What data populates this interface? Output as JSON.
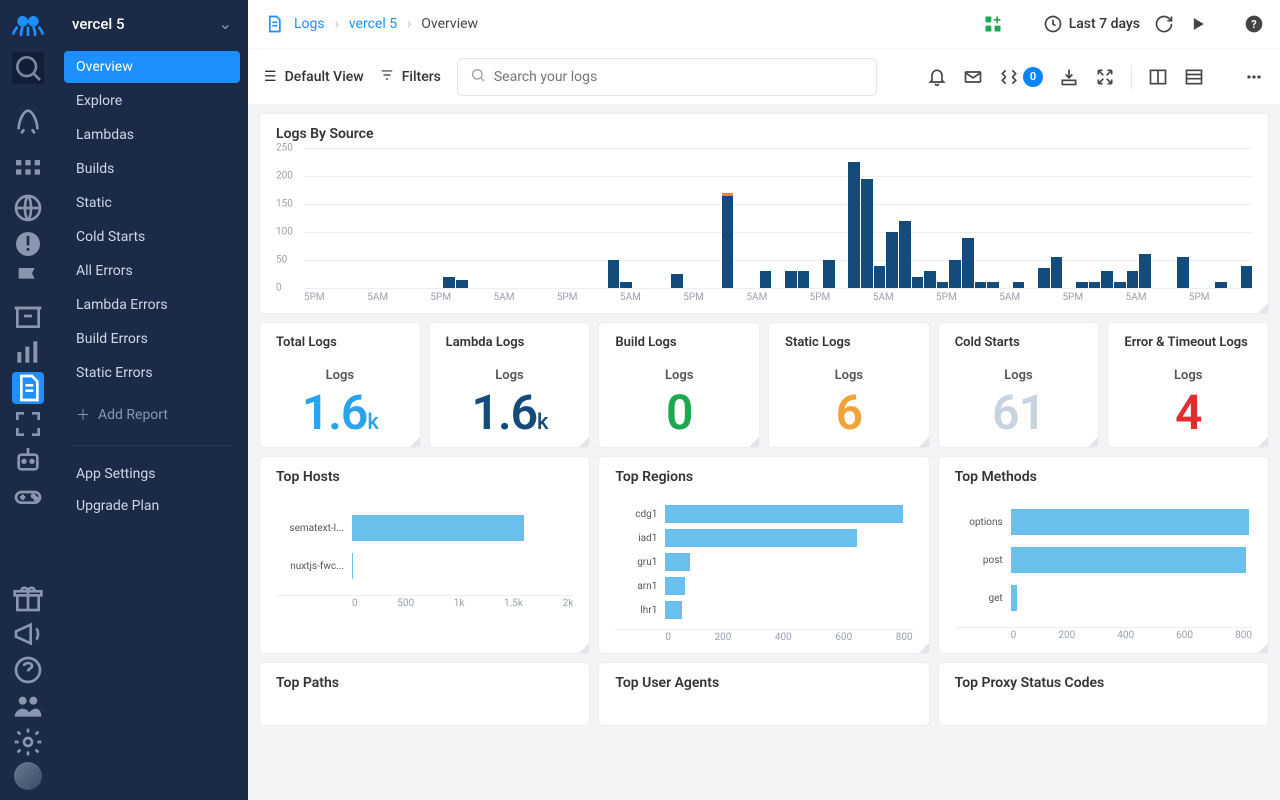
{
  "project_name": "vercel 5",
  "nav_items": [
    "Overview",
    "Explore",
    "Lambdas",
    "Builds",
    "Static",
    "Cold Starts",
    "All Errors",
    "Lambda Errors",
    "Build Errors",
    "Static Errors"
  ],
  "nav_active_index": 0,
  "add_report_label": "Add Report",
  "settings_links": [
    "App Settings",
    "Upgrade Plan"
  ],
  "breadcrumb": {
    "root": "Logs",
    "project": "vercel 5",
    "current": "Overview"
  },
  "time_range": "Last 7 days",
  "toolbar": {
    "default_view": "Default View",
    "filters": "Filters",
    "search_placeholder": "Search your logs",
    "bracket_badge": "0"
  },
  "logs_by_source_title": "Logs By Source",
  "metrics": [
    {
      "title": "Total Logs",
      "sub": "Logs",
      "value": "1.6",
      "unit": "k",
      "color": "#2aa3ef"
    },
    {
      "title": "Lambda Logs",
      "sub": "Logs",
      "value": "1.6",
      "unit": "k",
      "color": "#134b7a"
    },
    {
      "title": "Build Logs",
      "sub": "Logs",
      "value": "0",
      "unit": "",
      "color": "#1aa94d"
    },
    {
      "title": "Static Logs",
      "sub": "Logs",
      "value": "6",
      "unit": "",
      "color": "#f1a33a"
    },
    {
      "title": "Cold Starts",
      "sub": "Logs",
      "value": "61",
      "unit": "",
      "color": "#c9d3df"
    },
    {
      "title": "Error & Timeout Logs",
      "sub": "Logs",
      "value": "4",
      "unit": "",
      "color": "#e12d2d"
    }
  ],
  "panel_titles": {
    "hosts": "Top Hosts",
    "regions": "Top Regions",
    "methods": "Top Methods",
    "paths": "Top Paths",
    "user_agents": "Top User Agents",
    "proxy": "Top Proxy Status Codes"
  },
  "chart_data": {
    "logs_by_source": {
      "type": "bar",
      "title": "Logs By Source",
      "ylabel": "",
      "xlabel": "",
      "ylim": [
        0,
        250
      ],
      "yticks": [
        0,
        50,
        100,
        150,
        200,
        250
      ],
      "xticks": [
        "5PM",
        "5AM",
        "5PM",
        "5AM",
        "5PM",
        "5AM",
        "5PM",
        "5AM",
        "5PM",
        "5AM",
        "5PM",
        "5AM",
        "5PM",
        "5AM",
        "5PM"
      ],
      "values": [
        0,
        0,
        0,
        0,
        0,
        0,
        0,
        0,
        0,
        0,
        0,
        20,
        15,
        0,
        0,
        0,
        0,
        0,
        0,
        0,
        0,
        0,
        0,
        0,
        50,
        10,
        0,
        0,
        0,
        25,
        0,
        0,
        0,
        170,
        0,
        0,
        30,
        0,
        30,
        30,
        0,
        50,
        0,
        225,
        195,
        40,
        100,
        120,
        20,
        30,
        10,
        50,
        90,
        10,
        10,
        0,
        10,
        0,
        35,
        55,
        0,
        10,
        10,
        30,
        10,
        30,
        60,
        0,
        0,
        55,
        0,
        0,
        10,
        0,
        40
      ],
      "orange_cap_indices": [
        33
      ]
    },
    "top_hosts": {
      "type": "bar",
      "orientation": "h",
      "categories": [
        "sematext-l...",
        "nuxtjs-fwc..."
      ],
      "values": [
        1550,
        5
      ],
      "xlim": [
        0,
        2000
      ],
      "xticks": [
        "0",
        "500",
        "1k",
        "1.5k",
        "2k"
      ]
    },
    "top_regions": {
      "type": "bar",
      "orientation": "h",
      "categories": [
        "cdg1",
        "iad1",
        "gru1",
        "arn1",
        "lhr1"
      ],
      "values": [
        770,
        620,
        80,
        65,
        55
      ],
      "xlim": [
        0,
        800
      ],
      "xticks": [
        "0",
        "200",
        "400",
        "600",
        "800"
      ]
    },
    "top_methods": {
      "type": "bar",
      "orientation": "h",
      "categories": [
        "options",
        "post",
        "get"
      ],
      "values": [
        790,
        780,
        20
      ],
      "xlim": [
        0,
        800
      ],
      "xticks": [
        "0",
        "200",
        "400",
        "600",
        "800"
      ]
    }
  }
}
